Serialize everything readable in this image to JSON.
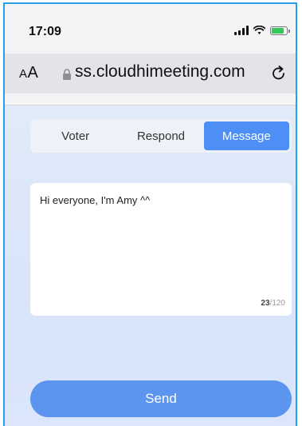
{
  "status_bar": {
    "time": "17:09",
    "icons": [
      "signal-icon",
      "wifi-icon",
      "battery-charging-icon"
    ]
  },
  "browser": {
    "text_size_label_small": "A",
    "text_size_label_large": "A",
    "url": "ss.cloudhimeeting.com",
    "icons": [
      "lock-icon",
      "reload-icon"
    ]
  },
  "tabs": [
    {
      "label": "Voter",
      "active": false
    },
    {
      "label": "Respond",
      "active": false
    },
    {
      "label": "Message",
      "active": true
    }
  ],
  "message": {
    "text": "Hi everyone, I'm Amy ^^",
    "char_count": "23",
    "char_separator": "/",
    "char_limit": "120"
  },
  "send_button": {
    "label": "Send"
  },
  "colors": {
    "accent": "#4d8ff5",
    "send": "#5b95f0",
    "frame_border": "#27a0e8"
  }
}
